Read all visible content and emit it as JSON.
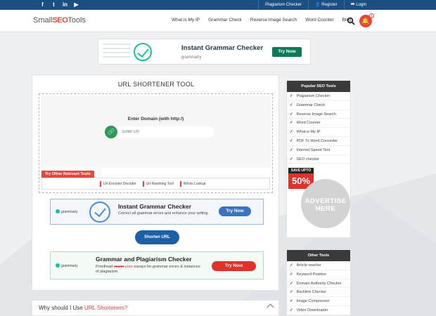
{
  "topbar": {
    "social": [
      "f",
      "t",
      "in",
      "▶"
    ],
    "links": [
      {
        "label": "Plagiarism Checker"
      },
      {
        "label": "👤 Register"
      },
      {
        "label": "⮕ Login"
      }
    ]
  },
  "nav": {
    "logo_small": "Small",
    "logo_seo": "SEO",
    "logo_tools": "Tools",
    "links": [
      "What is My IP",
      "Grammar Check",
      "Reverse Image Search",
      "Word Counter",
      "Blog"
    ],
    "notification_count": "1"
  },
  "ad_top": {
    "title": "Instant Grammar Checker",
    "brand": "grammarly",
    "button": "Try Now"
  },
  "tool": {
    "title": "URL SHORTENER TOOL",
    "input_label": "Enter Domain (with http:/)",
    "input_placeholder": "Enter Url",
    "other_tools_label": "Try Other Relevant Tools",
    "other_tools": [
      "Url Encoder Decoder",
      "Url Rewriting Tool",
      "Whois Lookup"
    ],
    "submit_button": "Shorten URL"
  },
  "ad_mid": {
    "brand": "grammarly",
    "title": "Instant Grammar Checker",
    "body": "Correct all grammar errors and enhance your writing.",
    "button": "Try Now"
  },
  "ad_bot": {
    "brand": "grammarly",
    "title": "Grammar and Plagiarism Checker",
    "body_prefix": "Proofread",
    "body_strike": "you're",
    "body_insert": "your",
    "body_suffix": "essays for grammar errors & instances of plagiarism.",
    "button": "Try Now"
  },
  "why": {
    "prefix": "Why should I Use ",
    "highlight": "URL Shorteners?"
  },
  "sidebar_popular": {
    "title": "Popular SEO Tools",
    "items": [
      "Plagiarism Checker",
      "Grammar Check",
      "Reverse Image Search",
      "Word Counter",
      "What is My IP",
      "PDF To Word Converter",
      "Internet Speed Test",
      "SEO checker"
    ],
    "save_upto": "SAVE UPTO",
    "save_pct": "50%",
    "advertise_line1": "ADVERTISE",
    "advertise_line2": "HERE"
  },
  "sidebar_other": {
    "title": "Other Tools",
    "items": [
      "Article rewriter",
      "Keyword Position",
      "Domain Authority Checker",
      "Backlink Checker",
      "Image Compressor",
      "Video Downloader"
    ]
  },
  "colors": {
    "topbar": "#1b4e82",
    "accent_red": "#e8463c",
    "grammarly_green": "#15c39a",
    "primary_blue": "#1b5fa8"
  }
}
